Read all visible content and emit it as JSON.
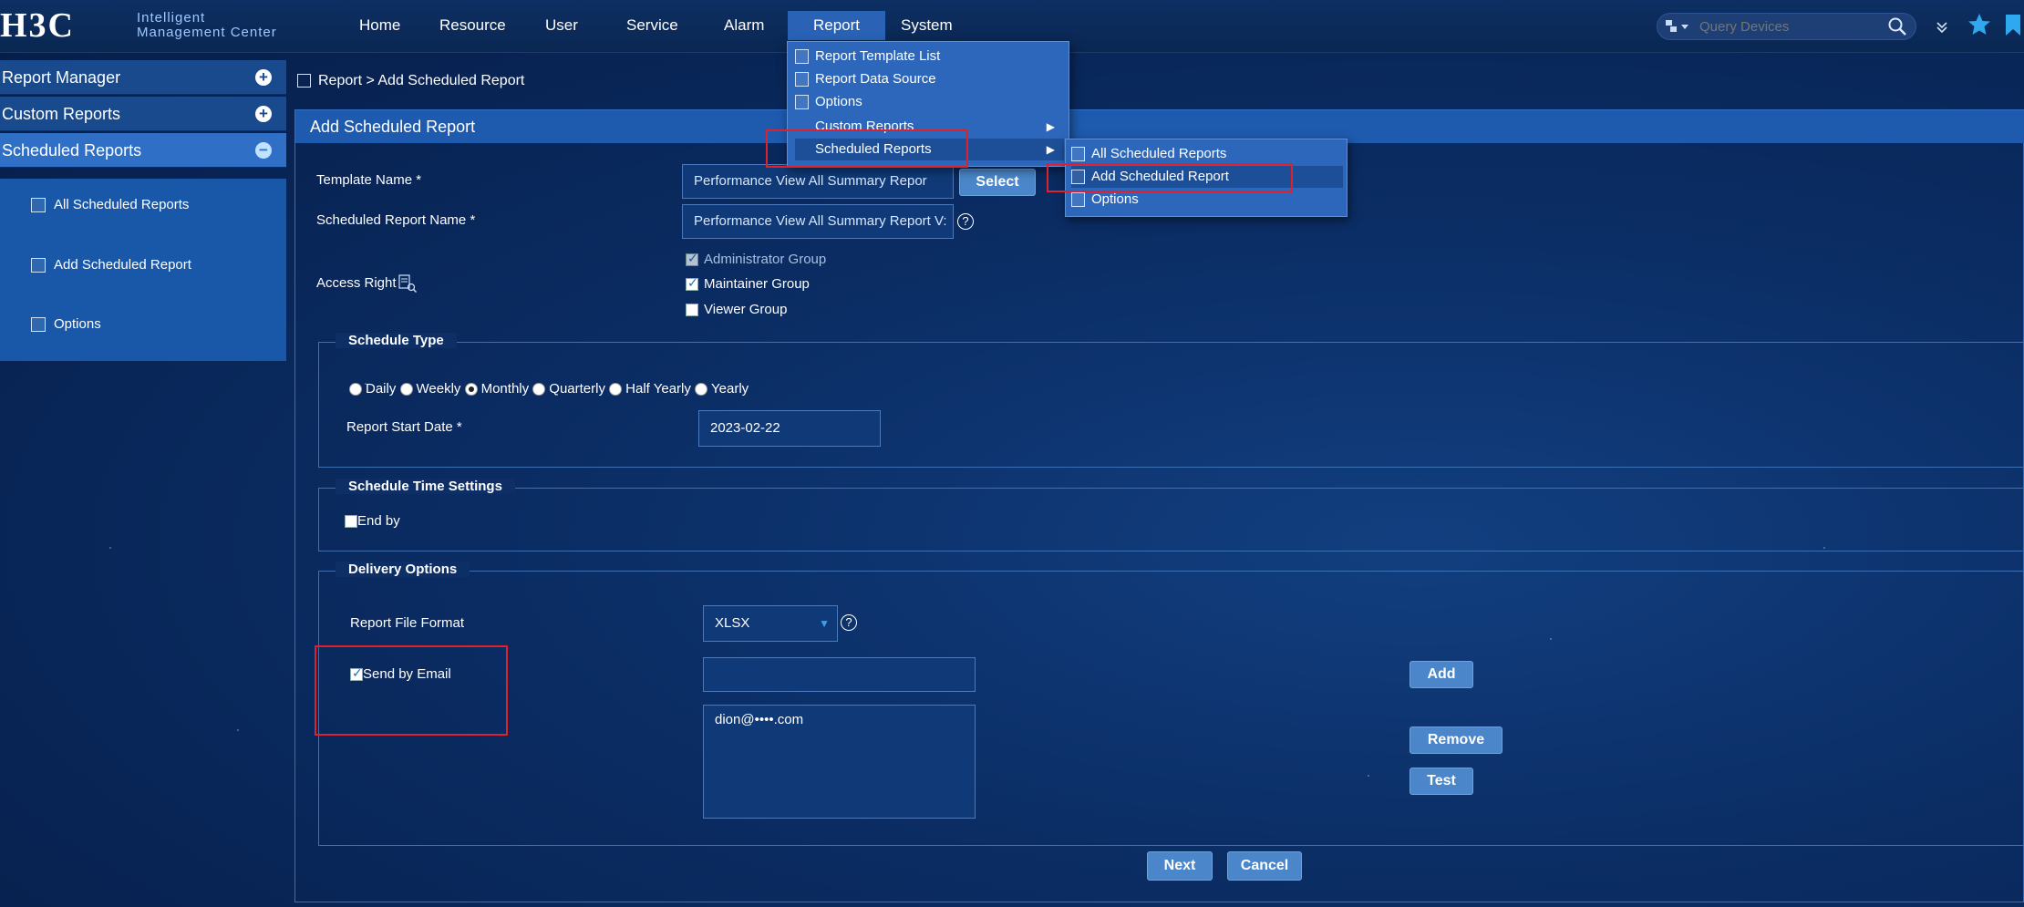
{
  "header": {
    "logo": "H3C",
    "logo_sub_line1": "Intelligent",
    "logo_sub_line2": "Management Center",
    "nav": [
      "Home",
      "Resource",
      "User",
      "Service",
      "Alarm",
      "Report",
      "System"
    ],
    "active_nav": "Report",
    "search_placeholder": "Query Devices"
  },
  "sidebar": {
    "sections": [
      {
        "label": "Report Manager",
        "state": "collapsed"
      },
      {
        "label": "Custom Reports",
        "state": "collapsed"
      },
      {
        "label": "Scheduled Reports",
        "state": "expanded"
      }
    ],
    "items": [
      {
        "label": "All Scheduled Reports",
        "icon": "edit-report-icon"
      },
      {
        "label": "Add Scheduled Report",
        "icon": "report-list-icon"
      },
      {
        "label": "Options",
        "icon": "options-icon"
      }
    ]
  },
  "breadcrumb": "Report > Add Scheduled Report",
  "panel_title": "Add Scheduled Report",
  "form": {
    "template_name_label": "Template Name",
    "template_name_value": "Performance View All Summary Repor",
    "select_button": "Select",
    "scheduled_name_label": "Scheduled Report Name",
    "scheduled_name_value": "Performance View All Summary Report V:",
    "access_right_label": "Access Right",
    "groups": [
      {
        "label": "Administrator Group",
        "checked": true,
        "disabled": true
      },
      {
        "label": "Maintainer Group",
        "checked": true
      },
      {
        "label": "Viewer Group",
        "checked": false
      }
    ],
    "required_mark": "*",
    "help_mark": "?"
  },
  "schedule_type": {
    "legend": "Schedule Type",
    "options": [
      "Daily",
      "Weekly",
      "Monthly",
      "Quarterly",
      "Half Yearly",
      "Yearly"
    ],
    "selected": "Monthly",
    "start_date_label": "Report Start Date",
    "start_date_value": "2023-02-22"
  },
  "schedule_time": {
    "legend": "Schedule Time Settings",
    "end_by_label": "End by",
    "end_by_checked": false
  },
  "delivery": {
    "legend": "Delivery Options",
    "format_label": "Report File Format",
    "format_value": "XLSX",
    "send_email_label": "Send by Email",
    "send_email_checked": true,
    "email_input_value": "",
    "email_list": [
      "dion@••••.com"
    ],
    "add_button": "Add",
    "remove_button": "Remove",
    "test_button": "Test"
  },
  "footer": {
    "next_button": "Next",
    "cancel_button": "Cancel"
  },
  "report_menu": {
    "items": [
      "Report Template List",
      "Report Data Source",
      "Options",
      "Custom Reports",
      "Scheduled Reports"
    ],
    "highlighted": "Scheduled Reports"
  },
  "scheduled_submenu": {
    "items": [
      "All Scheduled Reports",
      "Add Scheduled Report",
      "Options"
    ],
    "highlighted": "Add Scheduled Report"
  },
  "colors": {
    "accent": "#2f6fc6",
    "highlight_box": "#e0202a",
    "background": "#0b2e66"
  }
}
